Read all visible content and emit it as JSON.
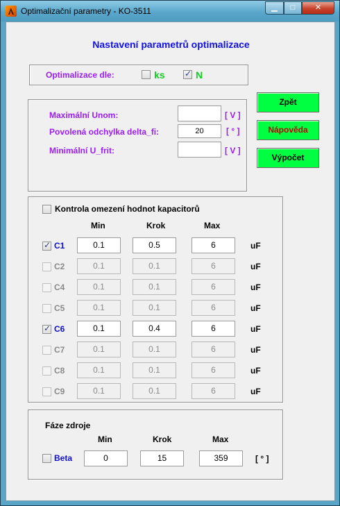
{
  "window": {
    "title": "Optimalizační parametry - KO-3511",
    "controls": {
      "minimize": "▁",
      "maximize": "□",
      "close": "✕"
    }
  },
  "heading": "Nastavení parametrů optimalizace",
  "optimization": {
    "label": "Optimalizace dle:",
    "options": [
      {
        "label": "ks",
        "checked": false
      },
      {
        "label": "N",
        "checked": true
      }
    ]
  },
  "params": {
    "rows": [
      {
        "label": "Maximální Unom:",
        "value": "",
        "unit": "[ V ]"
      },
      {
        "label": "Povolená odchylka delta_fi:",
        "value": "20",
        "unit": "[ ° ]"
      },
      {
        "label": "Minimální U_frit:",
        "value": "",
        "unit": "[ V ]"
      }
    ]
  },
  "buttons": {
    "back": "Zpět",
    "help": "Nápověda",
    "compute": "Výpočet"
  },
  "capacitors": {
    "title": "Kontrola omezení hodnot kapacitorů",
    "title_checked": false,
    "headers": {
      "min": "Min",
      "step": "Krok",
      "max": "Max"
    },
    "unit": "uF",
    "rows": [
      {
        "label": "C1",
        "checked": true,
        "min": "0.1",
        "step": "0.5",
        "max": "6"
      },
      {
        "label": "C2",
        "checked": false,
        "min": "0.1",
        "step": "0.1",
        "max": "6"
      },
      {
        "label": "C4",
        "checked": false,
        "min": "0.1",
        "step": "0.1",
        "max": "6"
      },
      {
        "label": "C5",
        "checked": false,
        "min": "0.1",
        "step": "0.1",
        "max": "6"
      },
      {
        "label": "C6",
        "checked": true,
        "min": "0.1",
        "step": "0.4",
        "max": "6"
      },
      {
        "label": "C7",
        "checked": false,
        "min": "0.1",
        "step": "0.1",
        "max": "6"
      },
      {
        "label": "C8",
        "checked": false,
        "min": "0.1",
        "step": "0.1",
        "max": "6"
      },
      {
        "label": "C9",
        "checked": false,
        "min": "0.1",
        "step": "0.1",
        "max": "6"
      }
    ]
  },
  "phase": {
    "title": "Fáze zdroje",
    "headers": {
      "min": "Min",
      "step": "Krok",
      "max": "Max"
    },
    "beta": {
      "label": "Beta",
      "checked": false,
      "min": "0",
      "step": "15",
      "max": "359"
    },
    "unit": "[ ° ]"
  },
  "colors": {
    "heading": "#1010e8",
    "label_purple": "#9a1ef0",
    "label_green": "#10d020",
    "button_green": "#00ff40",
    "button_red_text": "#c00000",
    "titlebar": "#5aa7cb"
  }
}
